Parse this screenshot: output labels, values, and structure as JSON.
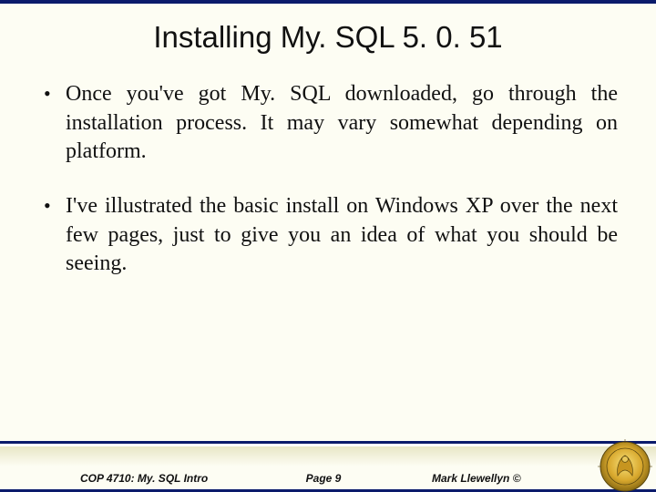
{
  "title": "Installing My. SQL 5. 0. 51",
  "bullets": [
    "Once you've got My. SQL downloaded, go through the installation process.  It may vary somewhat depending on platform.",
    "I've illustrated the basic install on Windows XP over the next few pages, just to give you an idea of what you should be seeing."
  ],
  "footer": {
    "left": "COP 4710: My. SQL Intro",
    "center": "Page 9",
    "right": "Mark Llewellyn ©"
  }
}
